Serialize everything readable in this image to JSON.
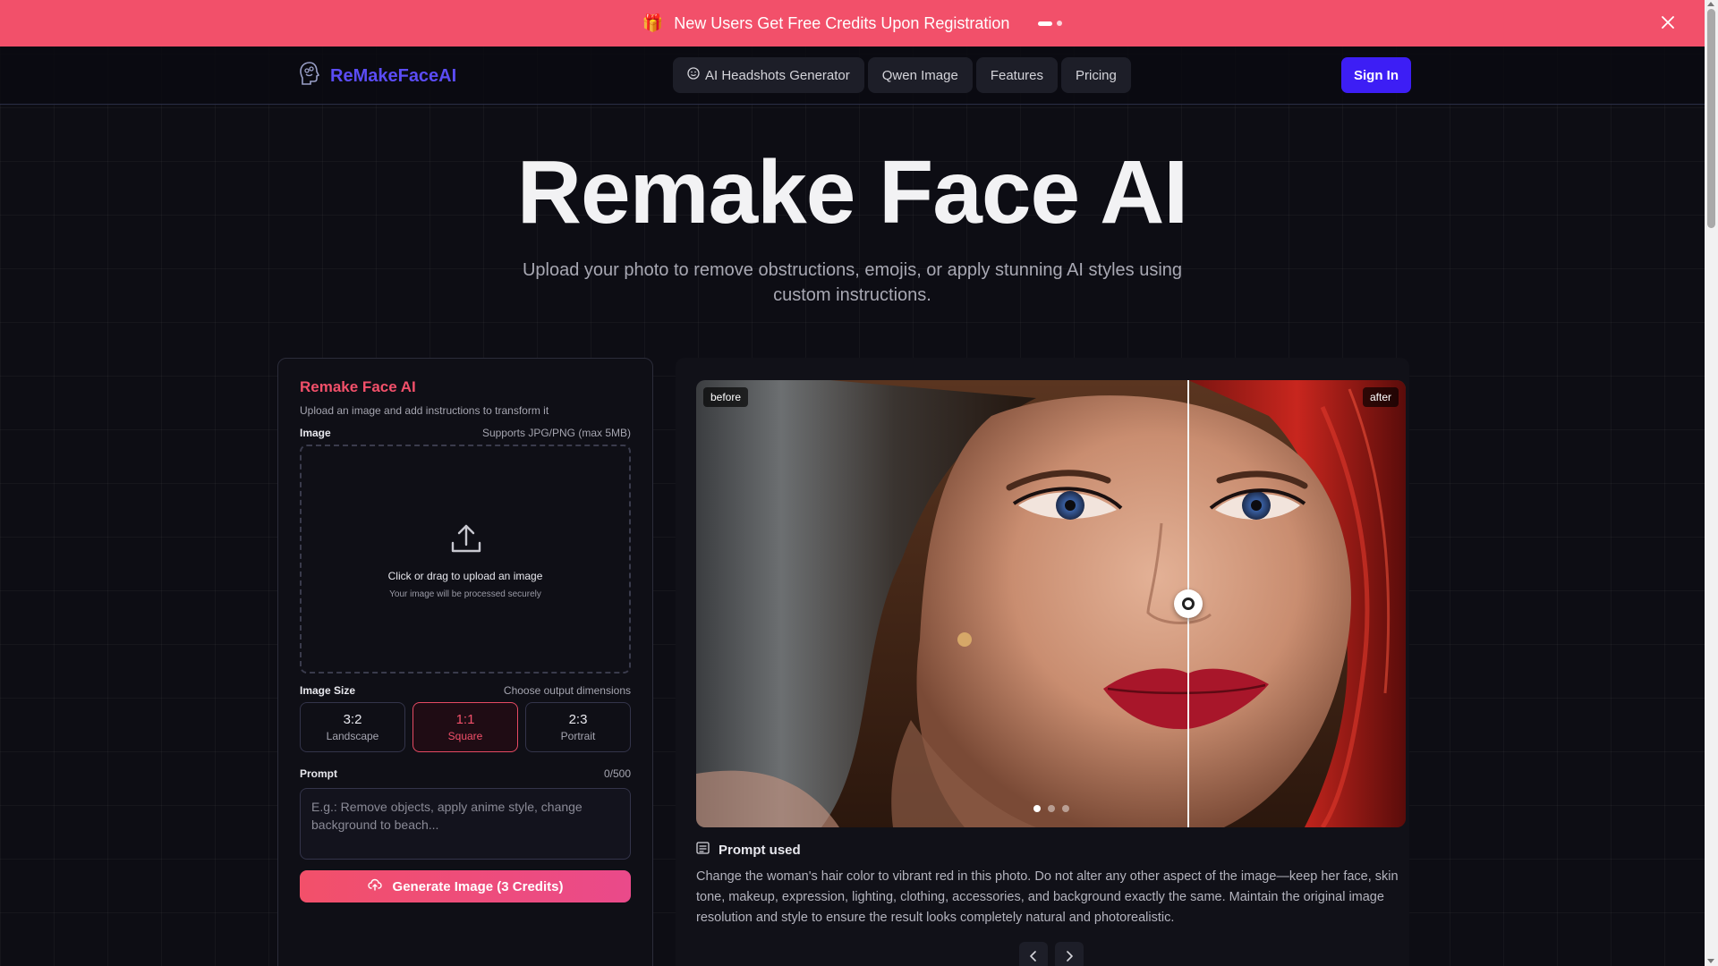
{
  "promo": {
    "text": "New Users Get Free Credits Upon Registration",
    "gift_icon": "gift-icon",
    "background": "#f2506a"
  },
  "header": {
    "brand": "ReMakeFaceAI",
    "brand_color": "#5b4cf5",
    "nav": [
      {
        "label": "AI Headshots Generator",
        "icon": "smile-icon"
      },
      {
        "label": "Qwen Image"
      },
      {
        "label": "Features"
      },
      {
        "label": "Pricing"
      }
    ],
    "signin_label": "Sign In",
    "signin_color": "#3d1ef5"
  },
  "hero": {
    "title": "Remake Face AI",
    "subtitle": "Upload your photo to remove obstructions, emojis, or apply stunning AI styles using custom instructions."
  },
  "form": {
    "title": "Remake Face AI",
    "description": "Upload an image and add instructions to transform it",
    "image_label": "Image",
    "image_hint": "Supports JPG/PNG (max 5MB)",
    "upload_main": "Click or drag to upload an image",
    "upload_sub": "Your image will be processed securely",
    "size_label": "Image Size",
    "size_hint": "Choose output dimensions",
    "sizes": [
      {
        "ratio": "3:2",
        "name": "Landscape",
        "selected": false
      },
      {
        "ratio": "1:1",
        "name": "Square",
        "selected": true
      },
      {
        "ratio": "2:3",
        "name": "Portrait",
        "selected": false
      }
    ],
    "prompt_label": "Prompt",
    "prompt_count": "0/500",
    "prompt_value": "",
    "prompt_placeholder": "E.g.: Remove objects, apply anime style, change background to beach...",
    "generate_label": "Generate Image (3 Credits)",
    "accent": "#f2506a"
  },
  "showcase": {
    "before_label": "before",
    "after_label": "after",
    "active_slide": 1,
    "slide_count": 3,
    "prompt_used_label": "Prompt used",
    "prompt_used_text": "Change the woman's hair color to vibrant red in this photo. Do not alter any other aspect of the image—keep her face, skin tone, makeup, expression, lighting, clothing, accessories, and background exactly the same. Maintain the original image resolution and style to ensure the result looks completely natural and photorealistic."
  }
}
